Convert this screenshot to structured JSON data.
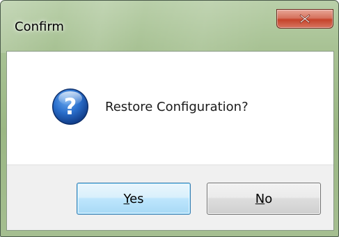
{
  "window": {
    "title": "Confirm",
    "close_icon": "close-icon"
  },
  "dialog": {
    "icon": "question-icon",
    "message": "Restore Configuration?"
  },
  "buttons": {
    "yes": {
      "mnemonic": "Y",
      "rest": "es"
    },
    "no": {
      "mnemonic": "N",
      "rest": "o"
    }
  },
  "colors": {
    "close_button": "#c5432a",
    "default_button_border": "#3c7fb1",
    "icon_blue": "#1b5fb4"
  }
}
